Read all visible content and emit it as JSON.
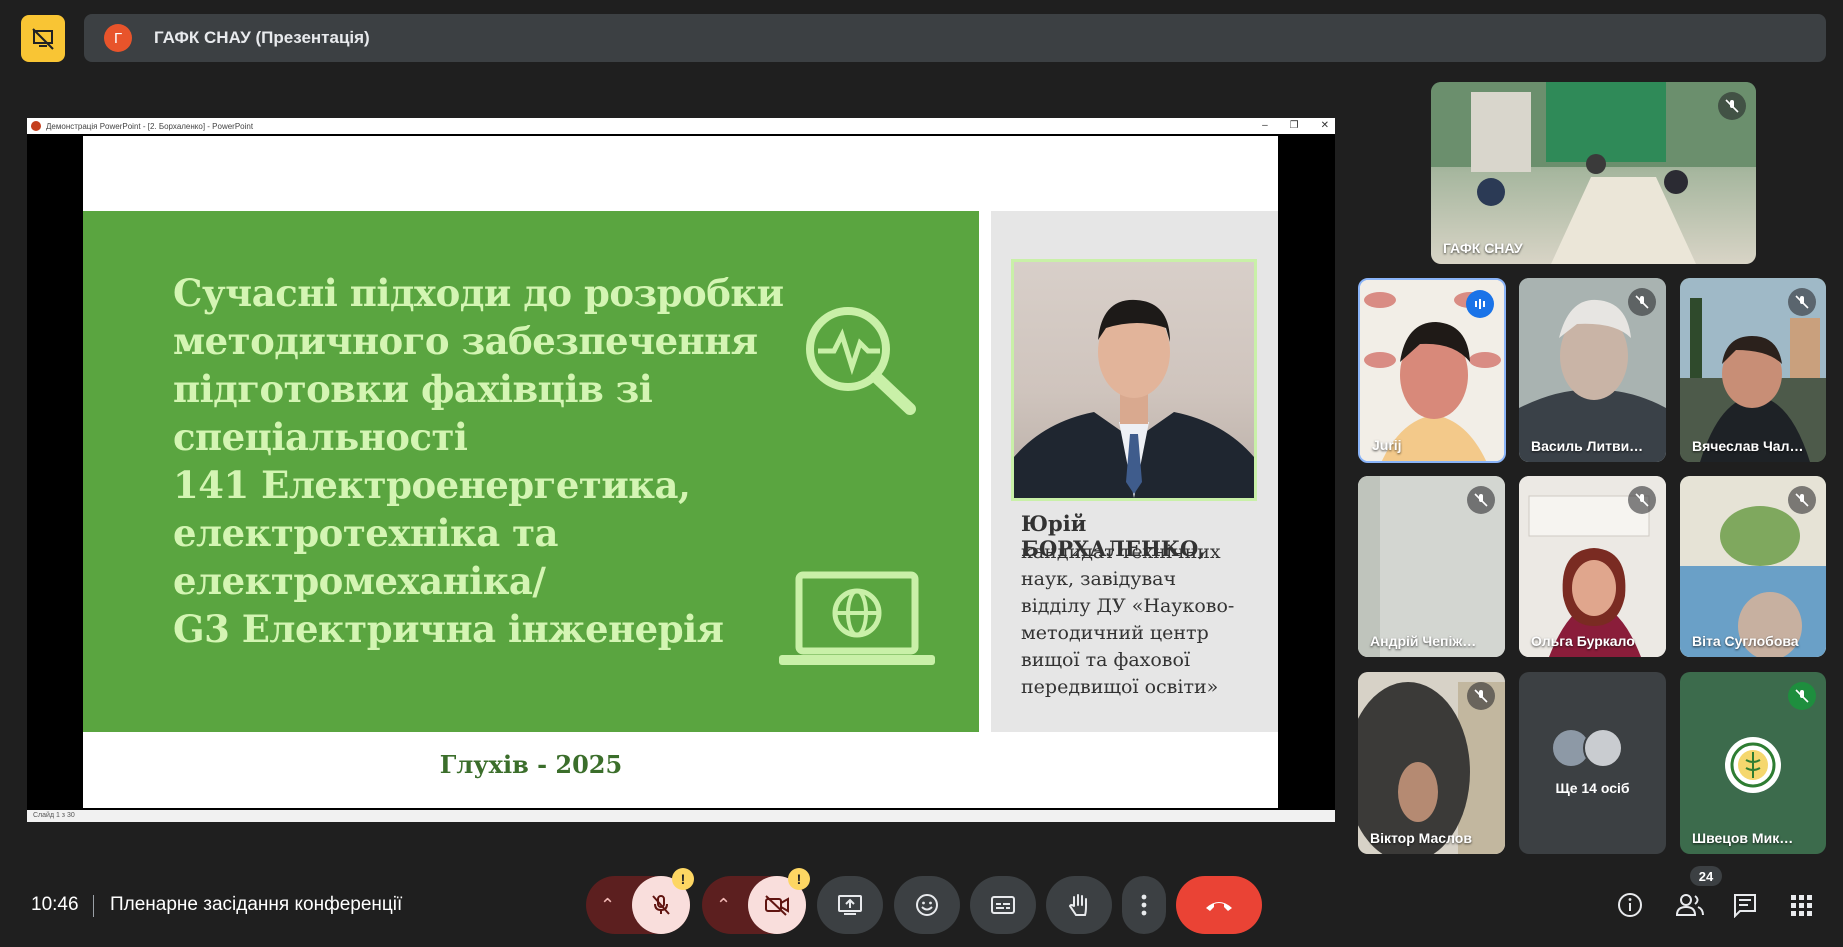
{
  "header": {
    "avatar_letter": "Г",
    "presentation_title": "ГАФК СНАУ (Презентація)"
  },
  "powerpoint": {
    "window_title": "Демонстрація PowerPoint - [2. Борхаленко] - PowerPoint",
    "status": "Слайд 1 з 30",
    "slide": {
      "title_lines": [
        "Сучасні підходи до розробки",
        "методичного забезпечення",
        "підготовки фахівців зі",
        "спеціальності",
        "141 Електроенергетика,",
        "електротехніка та",
        "електромеханіка/",
        "G3 Електрична інженерія"
      ],
      "speaker_name": "Юрій БОРХАЛЕНКО,",
      "speaker_desc_lines": [
        "кандидат технічних",
        "наук, завідувач",
        "відділу ДУ «Науково-",
        "методичний центр",
        "вищої та фахової",
        "передвищої освіти»"
      ],
      "city_year": "Глухів - 2025"
    }
  },
  "participants": {
    "main": {
      "name": "ГАФК СНАУ"
    },
    "tiles": [
      {
        "name": "Jurij",
        "speaking": true
      },
      {
        "name": "Василь Литви…"
      },
      {
        "name": "Вячеслав Чал…"
      },
      {
        "name": "Андрій Чепіж…"
      },
      {
        "name": "Ольга Буркало"
      },
      {
        "name": "Віта Суглобова"
      },
      {
        "name": "Віктор Маслов"
      },
      {
        "name": "Ще 14 осіб"
      },
      {
        "name": "Швецов Мик…"
      }
    ]
  },
  "footer": {
    "time": "10:46",
    "meeting_name": "Пленарне засідання конференції",
    "people_count": "24"
  },
  "colors": {
    "slide_green": "#5aa540",
    "title_text": "#d4f5b3",
    "end_call": "#ea4335",
    "present_icon": "#f9c534"
  }
}
